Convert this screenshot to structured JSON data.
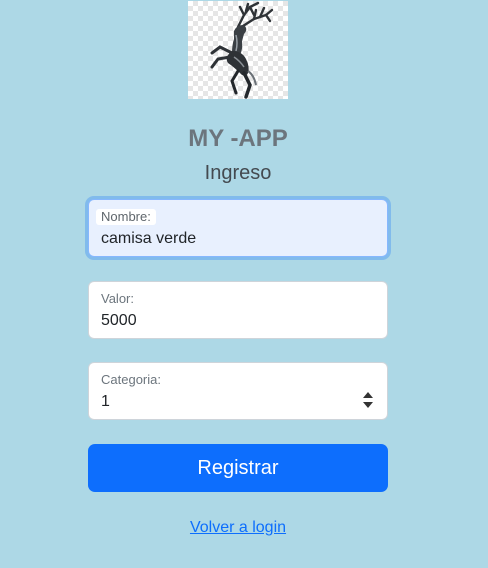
{
  "logo": {
    "icon": "stag-emblem-icon"
  },
  "header": {
    "title": "MY -APP",
    "subtitle": "Ingreso"
  },
  "form": {
    "nombre": {
      "label": "Nombre:",
      "value": "camisa verde"
    },
    "valor": {
      "label": "Valor:",
      "value": "5000"
    },
    "categoria": {
      "label": "Categoria:",
      "value": "1"
    },
    "submit_label": "Registrar"
  },
  "links": {
    "back_label": "Volver a login"
  },
  "colors": {
    "background": "#add8e6",
    "primary": "#0d6efd",
    "title": "#6c757d"
  }
}
